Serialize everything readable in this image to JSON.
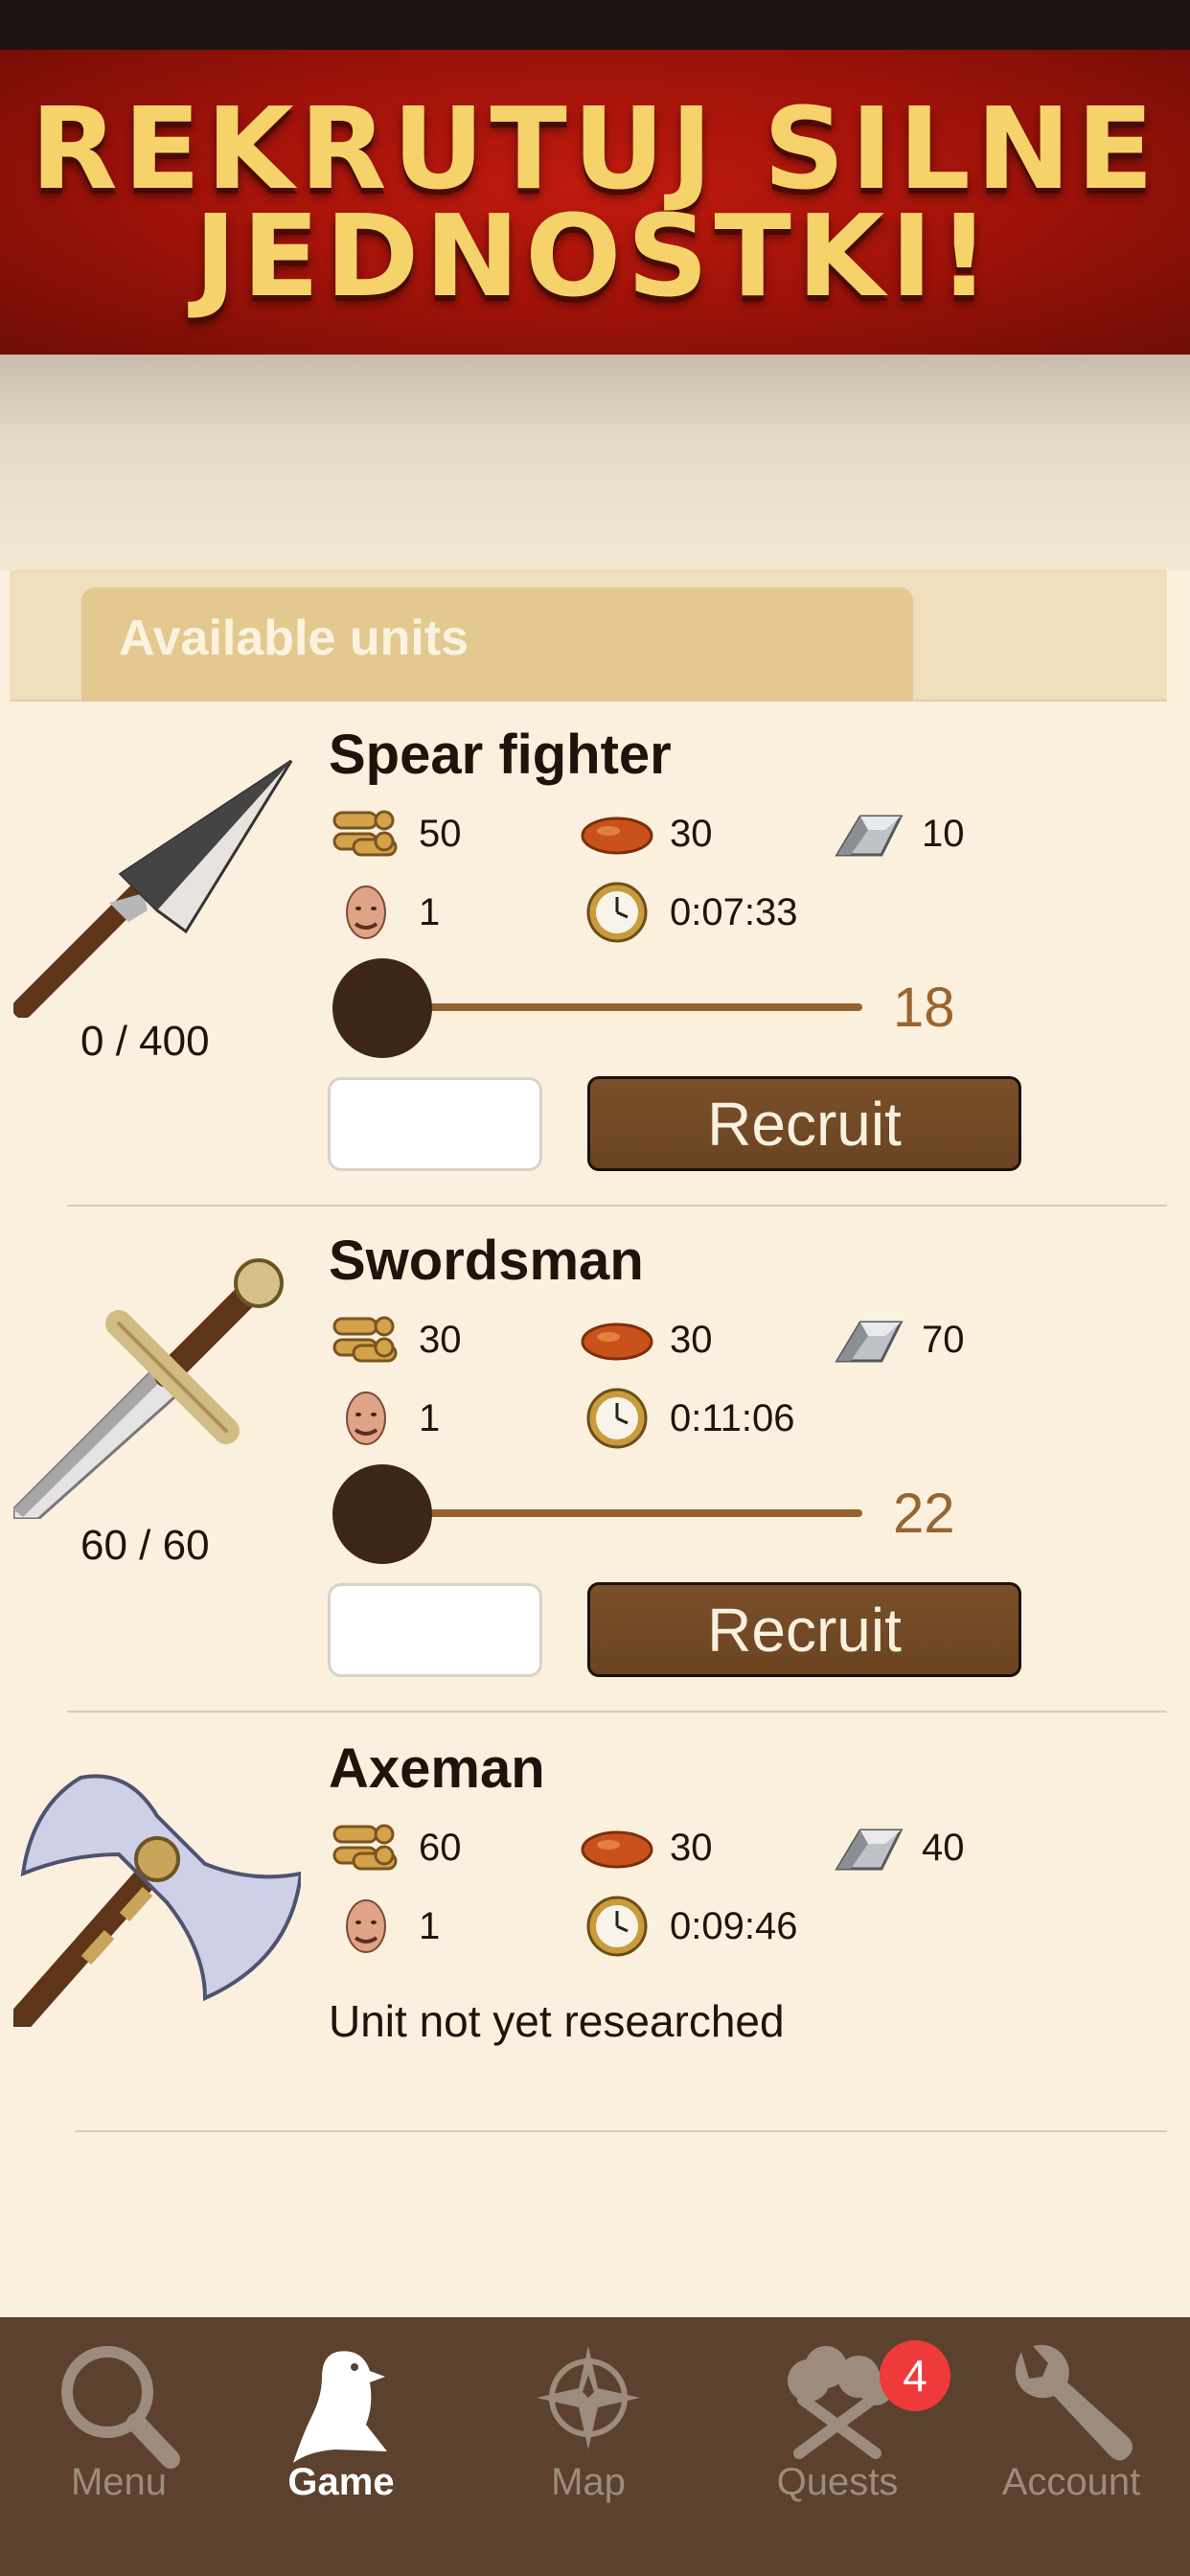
{
  "banner": {
    "title": "REKRUTUJ SILNE JEDNOSTKI!"
  },
  "section": {
    "title": "Available units"
  },
  "units": [
    {
      "name": "Spear fighter",
      "wood": "50",
      "clay": "30",
      "iron": "10",
      "pop": "1",
      "time": "0:07:33",
      "count": "0 / 400",
      "slider_value": "18",
      "recruit_label": "Recruit",
      "amount_value": "",
      "icon": "spear-icon"
    },
    {
      "name": "Swordsman",
      "wood": "30",
      "clay": "30",
      "iron": "70",
      "pop": "1",
      "time": "0:11:06",
      "count": "60 / 60",
      "slider_value": "22",
      "recruit_label": "Recruit",
      "amount_value": "",
      "icon": "sword-icon"
    },
    {
      "name": "Axeman",
      "wood": "60",
      "clay": "30",
      "iron": "40",
      "pop": "1",
      "time": "0:09:46",
      "status": "Unit not yet researched",
      "icon": "axe-icon"
    }
  ],
  "tabs": [
    {
      "label": "Menu",
      "icon": "search-icon"
    },
    {
      "label": "Game",
      "icon": "bird-icon",
      "active": true
    },
    {
      "label": "Map",
      "icon": "compass-icon"
    },
    {
      "label": "Quests",
      "icon": "quests-icon",
      "badge": "4"
    },
    {
      "label": "Account",
      "icon": "wrench-icon"
    }
  ],
  "colors": {
    "banner_red": "#9c1209",
    "banner_text": "#f6d36a",
    "background": "#fbf0de",
    "button_brown": "#6a4422",
    "slider_value": "#99642f",
    "tabbar": "#5b412e",
    "badge": "#ee3a3a"
  }
}
